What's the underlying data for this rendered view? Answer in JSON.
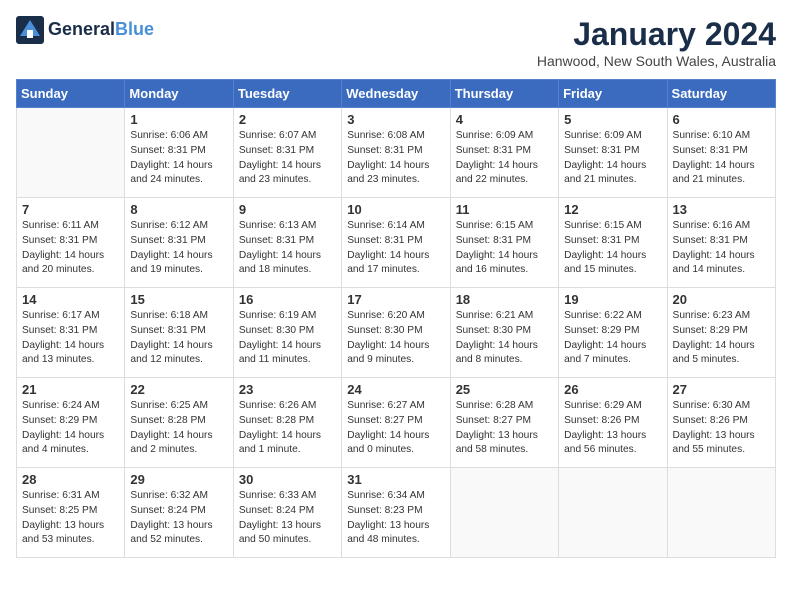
{
  "header": {
    "logo_line1": "General",
    "logo_line2": "Blue",
    "month_title": "January 2024",
    "location": "Hanwood, New South Wales, Australia"
  },
  "days_of_week": [
    "Sunday",
    "Monday",
    "Tuesday",
    "Wednesday",
    "Thursday",
    "Friday",
    "Saturday"
  ],
  "weeks": [
    [
      {
        "num": "",
        "info": ""
      },
      {
        "num": "1",
        "info": "Sunrise: 6:06 AM\nSunset: 8:31 PM\nDaylight: 14 hours\nand 24 minutes."
      },
      {
        "num": "2",
        "info": "Sunrise: 6:07 AM\nSunset: 8:31 PM\nDaylight: 14 hours\nand 23 minutes."
      },
      {
        "num": "3",
        "info": "Sunrise: 6:08 AM\nSunset: 8:31 PM\nDaylight: 14 hours\nand 23 minutes."
      },
      {
        "num": "4",
        "info": "Sunrise: 6:09 AM\nSunset: 8:31 PM\nDaylight: 14 hours\nand 22 minutes."
      },
      {
        "num": "5",
        "info": "Sunrise: 6:09 AM\nSunset: 8:31 PM\nDaylight: 14 hours\nand 21 minutes."
      },
      {
        "num": "6",
        "info": "Sunrise: 6:10 AM\nSunset: 8:31 PM\nDaylight: 14 hours\nand 21 minutes."
      }
    ],
    [
      {
        "num": "7",
        "info": "Sunrise: 6:11 AM\nSunset: 8:31 PM\nDaylight: 14 hours\nand 20 minutes."
      },
      {
        "num": "8",
        "info": "Sunrise: 6:12 AM\nSunset: 8:31 PM\nDaylight: 14 hours\nand 19 minutes."
      },
      {
        "num": "9",
        "info": "Sunrise: 6:13 AM\nSunset: 8:31 PM\nDaylight: 14 hours\nand 18 minutes."
      },
      {
        "num": "10",
        "info": "Sunrise: 6:14 AM\nSunset: 8:31 PM\nDaylight: 14 hours\nand 17 minutes."
      },
      {
        "num": "11",
        "info": "Sunrise: 6:15 AM\nSunset: 8:31 PM\nDaylight: 14 hours\nand 16 minutes."
      },
      {
        "num": "12",
        "info": "Sunrise: 6:15 AM\nSunset: 8:31 PM\nDaylight: 14 hours\nand 15 minutes."
      },
      {
        "num": "13",
        "info": "Sunrise: 6:16 AM\nSunset: 8:31 PM\nDaylight: 14 hours\nand 14 minutes."
      }
    ],
    [
      {
        "num": "14",
        "info": "Sunrise: 6:17 AM\nSunset: 8:31 PM\nDaylight: 14 hours\nand 13 minutes."
      },
      {
        "num": "15",
        "info": "Sunrise: 6:18 AM\nSunset: 8:31 PM\nDaylight: 14 hours\nand 12 minutes."
      },
      {
        "num": "16",
        "info": "Sunrise: 6:19 AM\nSunset: 8:30 PM\nDaylight: 14 hours\nand 11 minutes."
      },
      {
        "num": "17",
        "info": "Sunrise: 6:20 AM\nSunset: 8:30 PM\nDaylight: 14 hours\nand 9 minutes."
      },
      {
        "num": "18",
        "info": "Sunrise: 6:21 AM\nSunset: 8:30 PM\nDaylight: 14 hours\nand 8 minutes."
      },
      {
        "num": "19",
        "info": "Sunrise: 6:22 AM\nSunset: 8:29 PM\nDaylight: 14 hours\nand 7 minutes."
      },
      {
        "num": "20",
        "info": "Sunrise: 6:23 AM\nSunset: 8:29 PM\nDaylight: 14 hours\nand 5 minutes."
      }
    ],
    [
      {
        "num": "21",
        "info": "Sunrise: 6:24 AM\nSunset: 8:29 PM\nDaylight: 14 hours\nand 4 minutes."
      },
      {
        "num": "22",
        "info": "Sunrise: 6:25 AM\nSunset: 8:28 PM\nDaylight: 14 hours\nand 2 minutes."
      },
      {
        "num": "23",
        "info": "Sunrise: 6:26 AM\nSunset: 8:28 PM\nDaylight: 14 hours\nand 1 minute."
      },
      {
        "num": "24",
        "info": "Sunrise: 6:27 AM\nSunset: 8:27 PM\nDaylight: 14 hours\nand 0 minutes."
      },
      {
        "num": "25",
        "info": "Sunrise: 6:28 AM\nSunset: 8:27 PM\nDaylight: 13 hours\nand 58 minutes."
      },
      {
        "num": "26",
        "info": "Sunrise: 6:29 AM\nSunset: 8:26 PM\nDaylight: 13 hours\nand 56 minutes."
      },
      {
        "num": "27",
        "info": "Sunrise: 6:30 AM\nSunset: 8:26 PM\nDaylight: 13 hours\nand 55 minutes."
      }
    ],
    [
      {
        "num": "28",
        "info": "Sunrise: 6:31 AM\nSunset: 8:25 PM\nDaylight: 13 hours\nand 53 minutes."
      },
      {
        "num": "29",
        "info": "Sunrise: 6:32 AM\nSunset: 8:24 PM\nDaylight: 13 hours\nand 52 minutes."
      },
      {
        "num": "30",
        "info": "Sunrise: 6:33 AM\nSunset: 8:24 PM\nDaylight: 13 hours\nand 50 minutes."
      },
      {
        "num": "31",
        "info": "Sunrise: 6:34 AM\nSunset: 8:23 PM\nDaylight: 13 hours\nand 48 minutes."
      },
      {
        "num": "",
        "info": ""
      },
      {
        "num": "",
        "info": ""
      },
      {
        "num": "",
        "info": ""
      }
    ]
  ]
}
